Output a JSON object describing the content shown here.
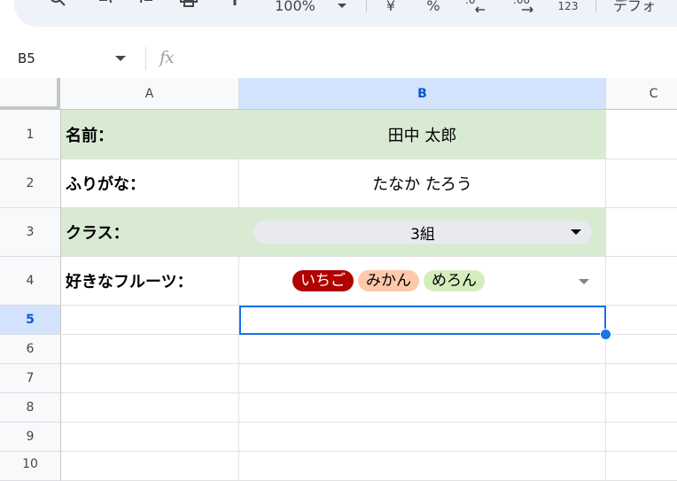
{
  "toolbar": {
    "zoom": "100%",
    "currency_symbol": "¥",
    "percent_symbol": "%",
    "number_format": "123",
    "font_label": "デフォ"
  },
  "formula_bar": {
    "cell_ref": "B5",
    "fx": "fx",
    "value": ""
  },
  "columns": [
    "A",
    "B",
    "C"
  ],
  "rows": [
    "1",
    "2",
    "3",
    "4",
    "5",
    "6",
    "7",
    "8",
    "9",
    "10"
  ],
  "selected_cell": "B5",
  "cells": {
    "a1": "名前：",
    "b1": "田中 太郎",
    "a2": "ふりがな：",
    "b2": "たなか たろう",
    "a3": "クラス：",
    "b3": "3組",
    "a4": "好きなフルーツ：",
    "b4_chips": [
      {
        "label": "いちご",
        "bg": "#b10202",
        "fg": "#ffffff"
      },
      {
        "label": "みかん",
        "bg": "#ffc8aa",
        "fg": "#000000"
      },
      {
        "label": "めろん",
        "bg": "#d4edbc",
        "fg": "#000000"
      }
    ]
  },
  "colors": {
    "label_fill": "#d9ead3",
    "selection": "#1a73e8",
    "header_selected": "#d3e3fd"
  }
}
